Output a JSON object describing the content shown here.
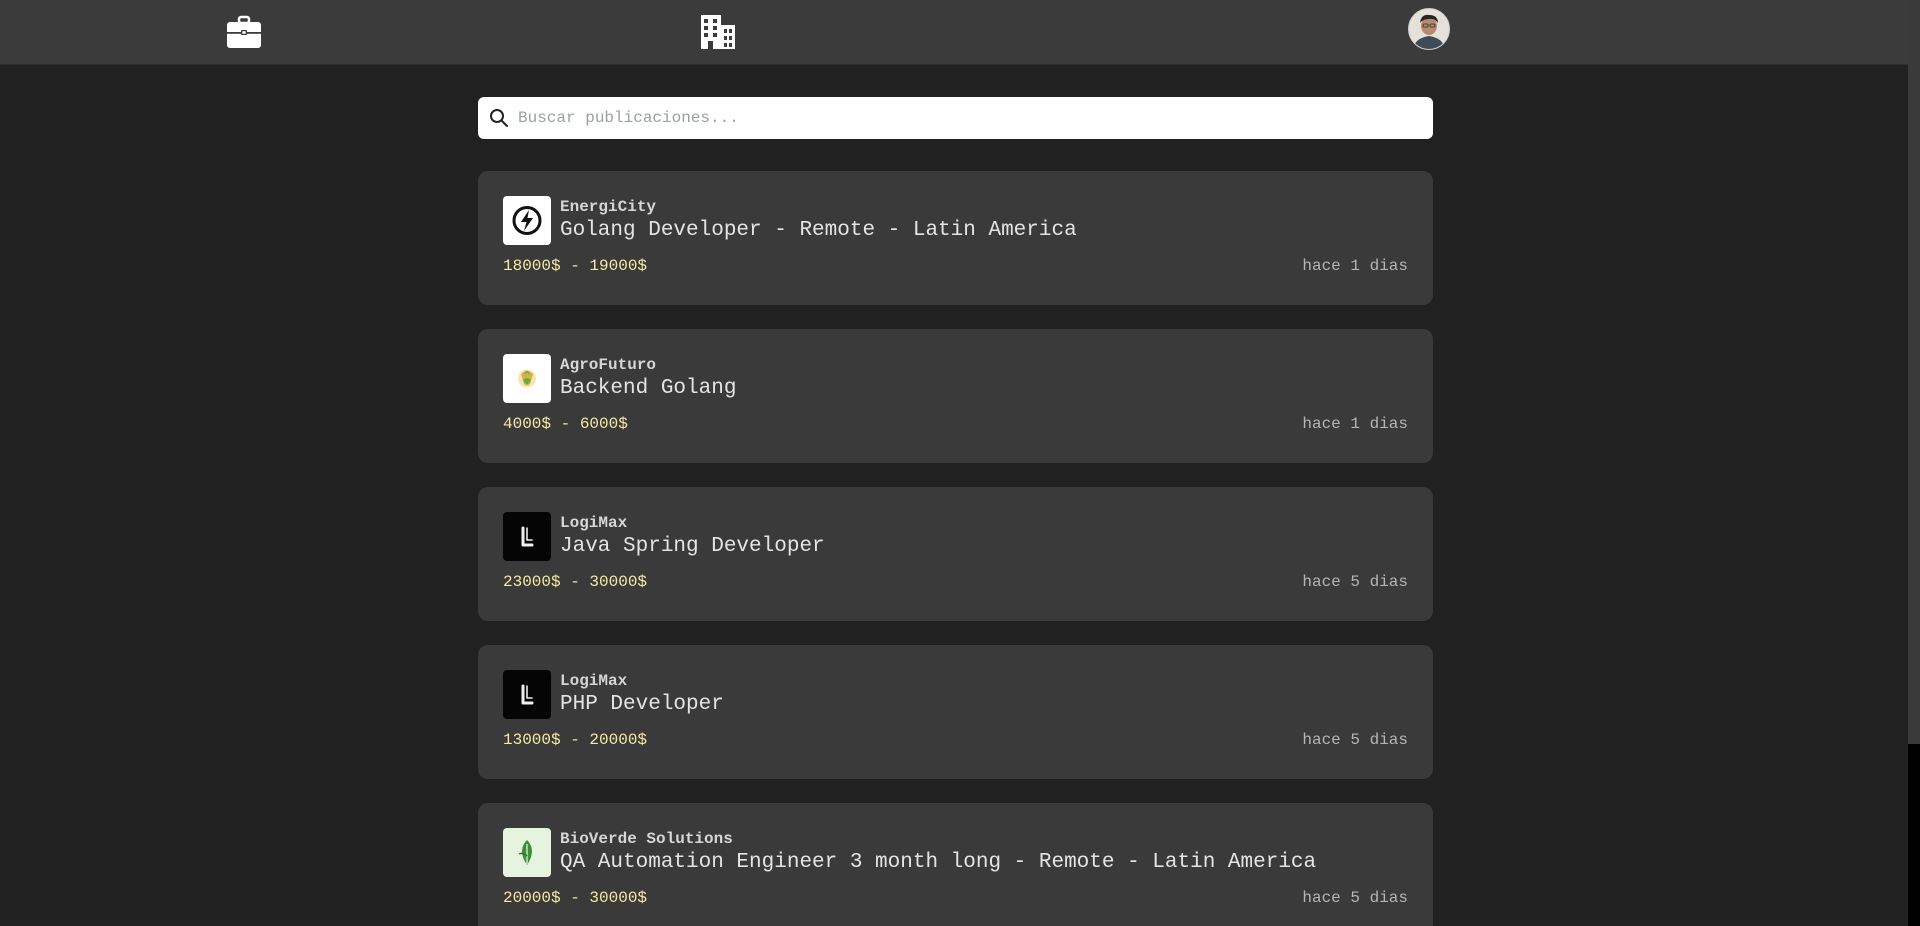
{
  "navbar": {
    "jobs_icon": "briefcase-icon",
    "companies_icon": "buildings-icon",
    "avatar_icon": "user-avatar"
  },
  "search": {
    "placeholder": "Buscar publicaciones...",
    "value": "",
    "icon": "search-icon"
  },
  "colors": {
    "background": "#212121",
    "navbar": "#3b3b3b",
    "card": "#3a3a3a",
    "salary": "#f5e9a6",
    "time": "#b5b5b5"
  },
  "jobs": [
    {
      "company": "EnergiCity",
      "title": "Golang Developer - Remote - Latin America",
      "salary": "18000$ - 19000$",
      "time": "hace 1 dias",
      "logo": "lightning-logo-icon"
    },
    {
      "company": "AgroFuturo",
      "title": "Backend Golang",
      "salary": "4000$ - 6000$",
      "time": "hace 1 dias",
      "logo": "agro-logo-icon"
    },
    {
      "company": "LogiMax",
      "title": "Java Spring Developer",
      "salary": "23000$ - 30000$",
      "time": "hace 5 dias",
      "logo": "letter-l-logo-icon"
    },
    {
      "company": "LogiMax",
      "title": "PHP Developer",
      "salary": "13000$ - 20000$",
      "time": "hace 5 dias",
      "logo": "letter-l-logo-icon"
    },
    {
      "company": "BioVerde Solutions",
      "title": "QA Automation Engineer 3 month long - Remote - Latin America",
      "salary": "20000$ - 30000$",
      "time": "hace 5 dias",
      "logo": "leaf-logo-icon"
    }
  ]
}
